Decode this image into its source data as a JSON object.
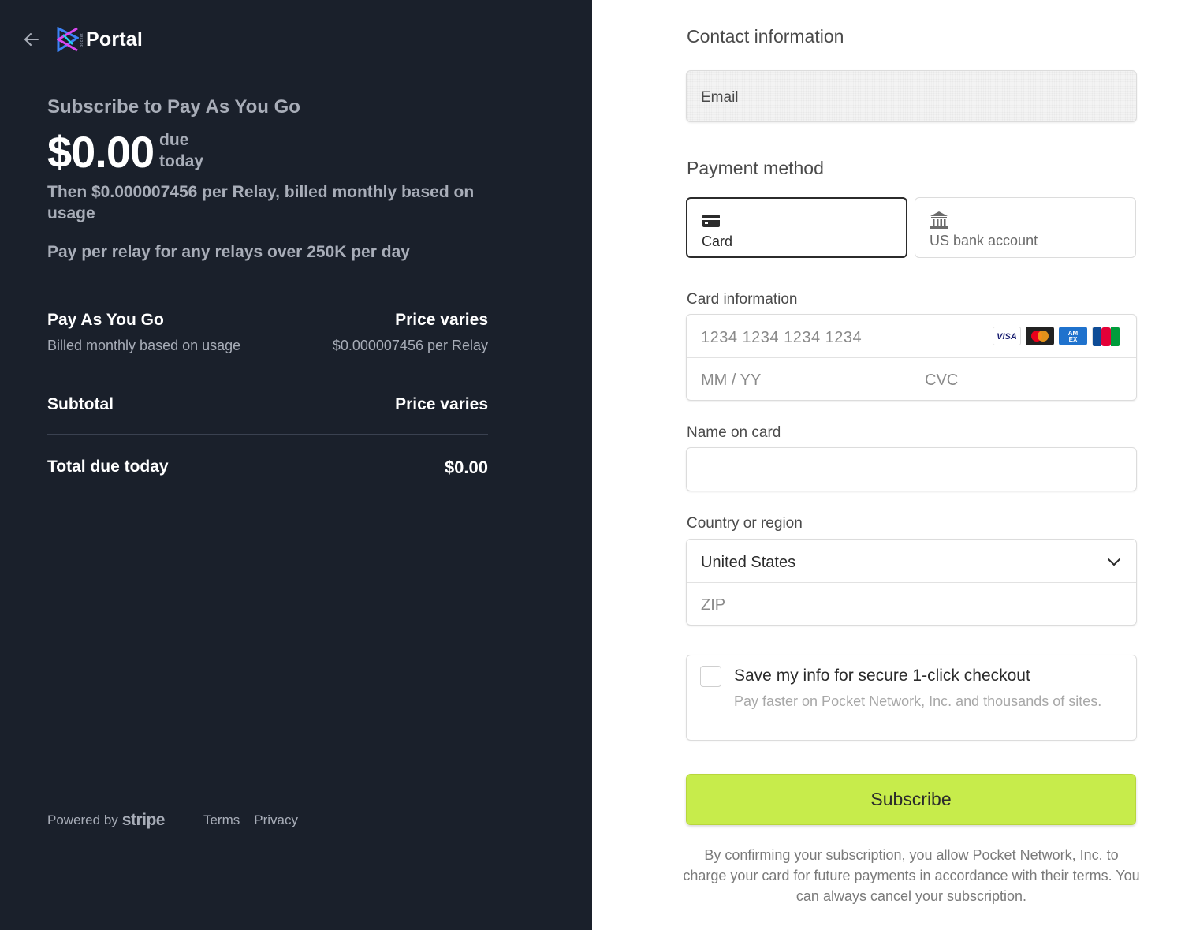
{
  "brand": {
    "name": "Portal",
    "small_text": "pocket"
  },
  "summary": {
    "title": "Subscribe to Pay As You Go",
    "amount": "$0.00",
    "due_label_1": "due",
    "due_label_2": "today",
    "then_text": "Then $0.000007456 per Relay, billed monthly based on usage",
    "relay_text": "Pay per relay for any relays over 250K per day"
  },
  "line_item": {
    "name": "Pay As You Go",
    "price": "Price varies",
    "subtitle": "Billed monthly based on usage",
    "unit_price": "$0.000007456 per Relay"
  },
  "subtotal": {
    "label": "Subtotal",
    "value": "Price varies"
  },
  "total": {
    "label": "Total due today",
    "value": "$0.00"
  },
  "footer": {
    "powered_by": "Powered by",
    "stripe": "stripe",
    "terms": "Terms",
    "privacy": "Privacy"
  },
  "contact": {
    "heading": "Contact information",
    "email_placeholder": "Email"
  },
  "payment": {
    "heading": "Payment method",
    "methods": [
      {
        "label": "Card",
        "icon": "card-icon",
        "selected": true
      },
      {
        "label": "US bank account",
        "icon": "bank-icon",
        "selected": false
      }
    ]
  },
  "card_info": {
    "label": "Card information",
    "number_placeholder": "1234 1234 1234 1234",
    "expiry_placeholder": "MM / YY",
    "cvc_placeholder": "CVC",
    "brands": [
      "visa",
      "mastercard",
      "amex",
      "jcb"
    ]
  },
  "name_on_card": {
    "label": "Name on card",
    "value": ""
  },
  "country": {
    "label": "Country or region",
    "selected": "United States",
    "zip_placeholder": "ZIP"
  },
  "save_info": {
    "title": "Save my info for secure 1-click checkout",
    "description": "Pay faster on Pocket Network, Inc. and thousands of sites."
  },
  "subscribe_label": "Subscribe",
  "confirm_text": "By confirming your subscription, you allow Pocket Network, Inc. to charge your card for future payments in accordance with their terms. You can always cancel your subscription.",
  "colors": {
    "left_bg": "#1a202b",
    "subscribe_bg": "#c7ec4b"
  }
}
